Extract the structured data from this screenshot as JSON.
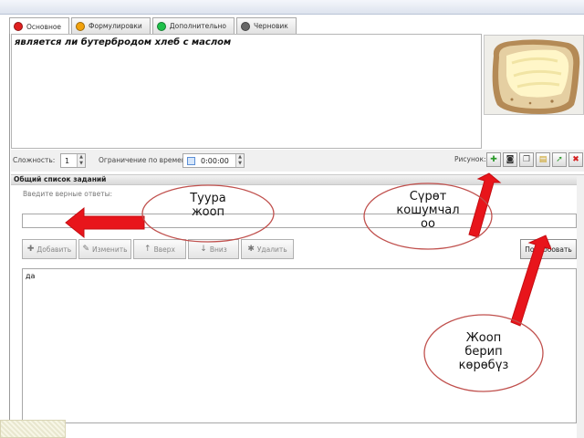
{
  "tabs": [
    {
      "label": "Основное",
      "color": "#e02020",
      "active": true
    },
    {
      "label": "Формулировки",
      "color": "#f2a20c",
      "active": false
    },
    {
      "label": "Дополнительно",
      "color": "#1ec04a",
      "active": false
    },
    {
      "label": "Черновик",
      "color": "#666666",
      "active": false
    }
  ],
  "question": {
    "text": "является ли бутербродом хлеб с маслом"
  },
  "settings": {
    "difficulty_label": "Сложность:",
    "difficulty_value": "1",
    "time_limit_label": "Ограничение по времени:",
    "time_value": "0:00:00",
    "pictures_label": "Рисунок:"
  },
  "toolbar_icons": [
    "add-picture-icon",
    "camera-icon",
    "copy-icon",
    "paste-icon",
    "export-icon",
    "delete-icon"
  ],
  "section": {
    "title": "Общий список заданий"
  },
  "answers": {
    "label": "Введите верные ответы:",
    "input_value": "",
    "buttons": {
      "add": "Добавить",
      "edit": "Изменить",
      "up": "Вверх",
      "down": "Вниз",
      "delete": "Удалить"
    },
    "try_button": "Попробовать",
    "items": [
      "да"
    ]
  },
  "callouts": {
    "correct_answer": [
      "Туура",
      "жооп"
    ],
    "add_picture": [
      "Сүрөт",
      "кошумчал",
      "оо"
    ],
    "try_answer": [
      "Жооп",
      "берип",
      "көрөбүз"
    ]
  },
  "colors": {
    "arrow": "#e8151b",
    "callout_border": "#c0504d"
  }
}
